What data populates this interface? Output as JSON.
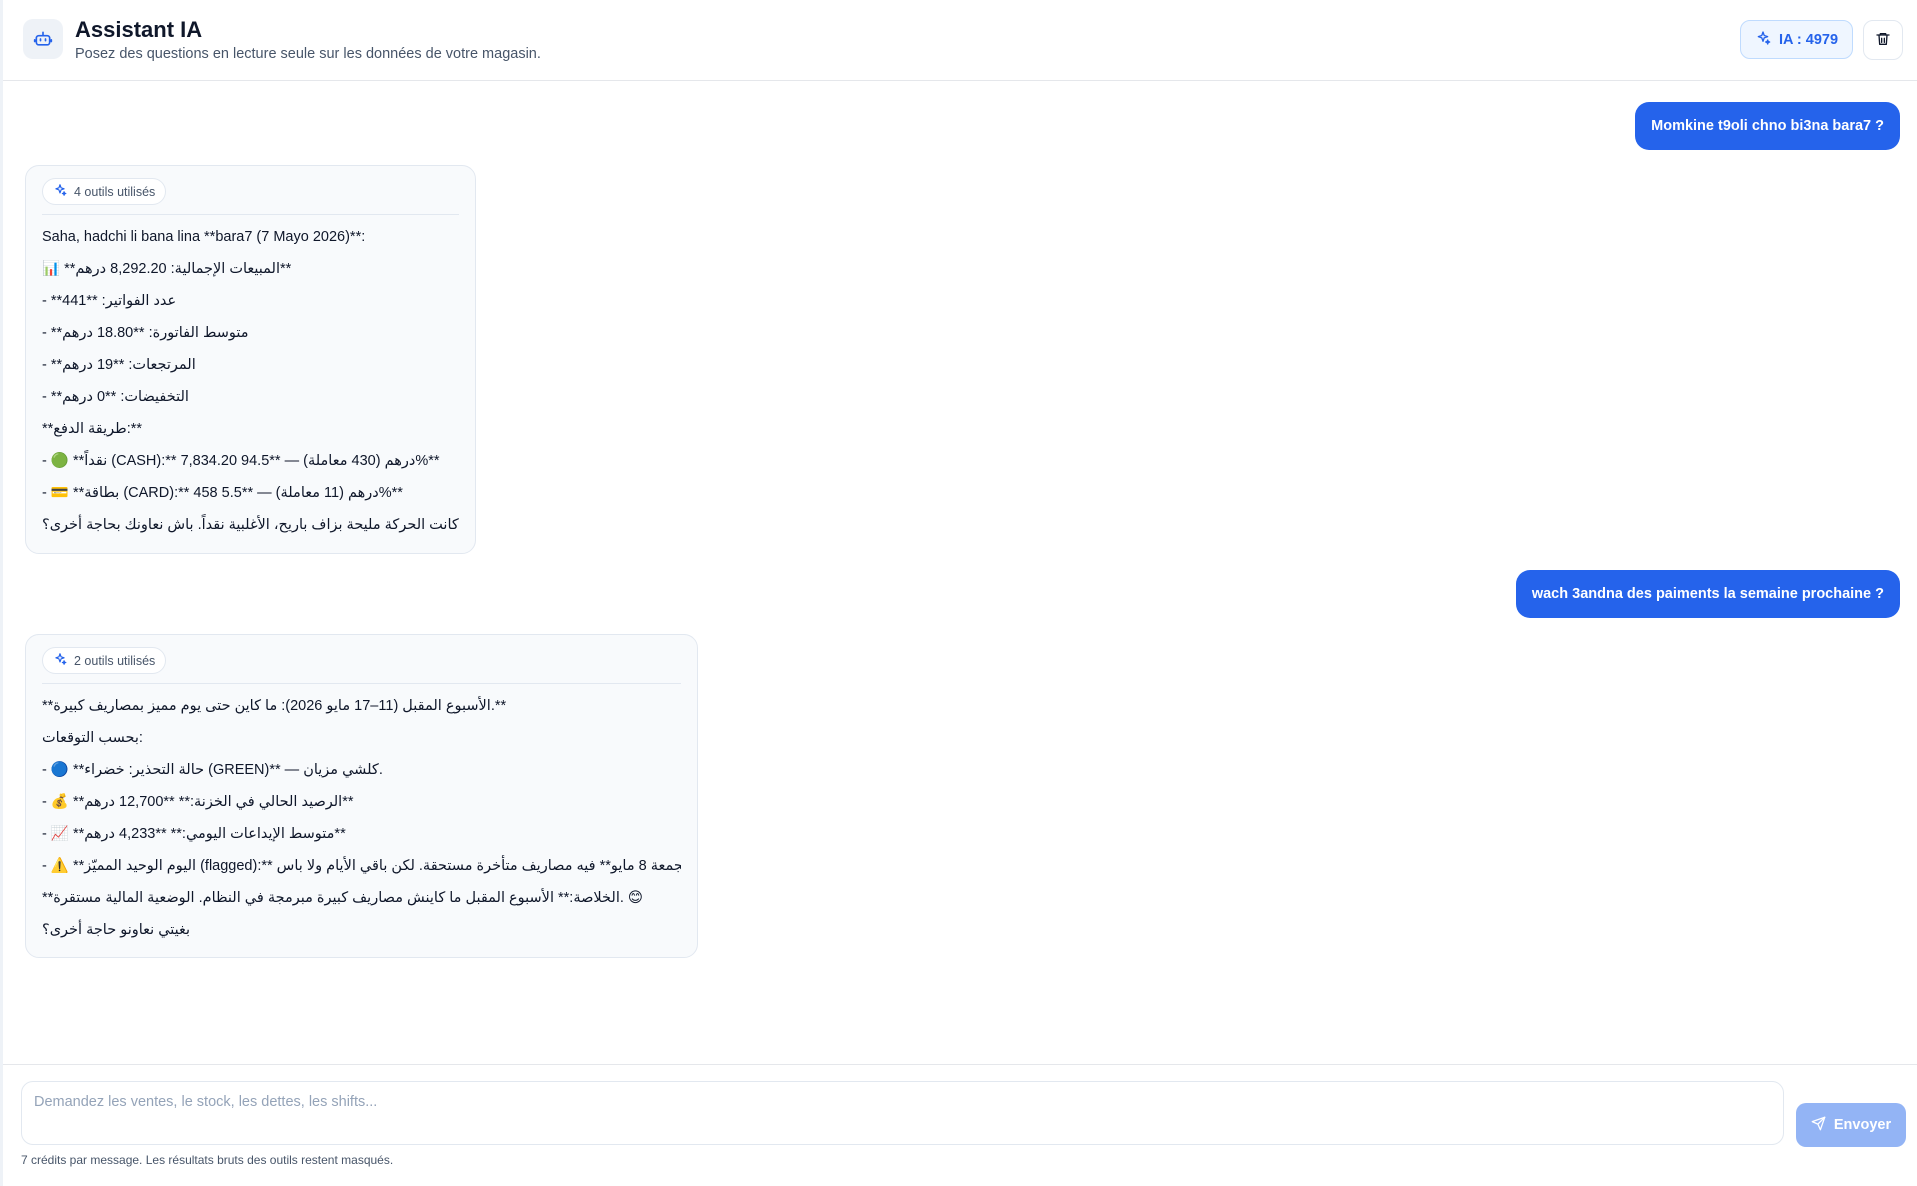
{
  "header": {
    "title": "Assistant IA",
    "subtitle": "Posez des questions en lecture seule sur les données de votre magasin.",
    "credits_label": "IA : 4979"
  },
  "colors": {
    "accent": "#2563eb",
    "send_disabled": "#93b4f5",
    "card_bg": "#f8fafc",
    "border": "#e2e8f0"
  },
  "icons": {
    "header": "robot-icon",
    "credits": "sparkles-icon",
    "clear": "trash-icon",
    "tools": "sparkles-icon",
    "send": "send-icon"
  },
  "messages": [
    {
      "role": "user",
      "text": "Momkine t9oli chno bi3na bara7 ?"
    },
    {
      "role": "assistant",
      "tools_label": "4 outils utilisés",
      "lines": [
        "Saha, hadchi li bana lina **bara7 (7 Mayo 2026)**:",
        "📊 **المبيعات الإجمالية: 8,292.20 درهم**",
        "- **عدد الفواتير: **441",
        "- **متوسط الفاتورة: **18.80 درهم",
        "- **المرتجعات: **19 درهم",
        "- **التخفيضات: **0 درهم",
        "**طريقة الدفع:**",
        "- 🟢 **نقداً (CASH):** 7,834.20 درهم (430 معاملة) — **94.5%**",
        "- 💳 **بطاقة (CARD):** 458 درهم (11 معاملة) — **5.5%**",
        "كانت الحركة مليحة بزاف باريح، الأغلبية نقداً. باش نعاونك بحاجة أخرى؟"
      ]
    },
    {
      "role": "user",
      "text": "wach 3andna des paiments la semaine prochaine ?"
    },
    {
      "role": "assistant",
      "tools_label": "2 outils utilisés",
      "lines": [
        "**الأسبوع المقبل (11–17 مايو 2026): ما كاين حتى يوم مميز بمصاريف كبيرة.**",
        "بحسب التوقعات:",
        "- 🔵 **حالة التحذير: خضراء (GREEN)** — كلشي مزيان.",
        "- 💰 **الرصيد الحالي في الخزنة:** **12,700 درهم**",
        "- 📈 **متوسط الإيداعات اليومي:** **4,233 درهم**",
        "- ⚠️ **اليوم الوحيد المميّز (flagged):** هو **اليوم الجمعة 8 مايو** فيه مصاريف متأخرة مستحقة. لكن باقي الأيام ولا باس.",
        "**الخلاصة:** الأسبوع المقبل ما كاينش مصاريف كبيرة مبرمجة في النظام. الوضعية المالية مستقرة. 😊",
        "بغيتي نعاونو حاجة أخرى؟"
      ]
    }
  ],
  "composer": {
    "placeholder": "Demandez les ventes, le stock, les dettes, les shifts...",
    "send_label": "Envoyer",
    "footer_note": "7 crédits par message. Les résultats bruts des outils restent masqués."
  }
}
